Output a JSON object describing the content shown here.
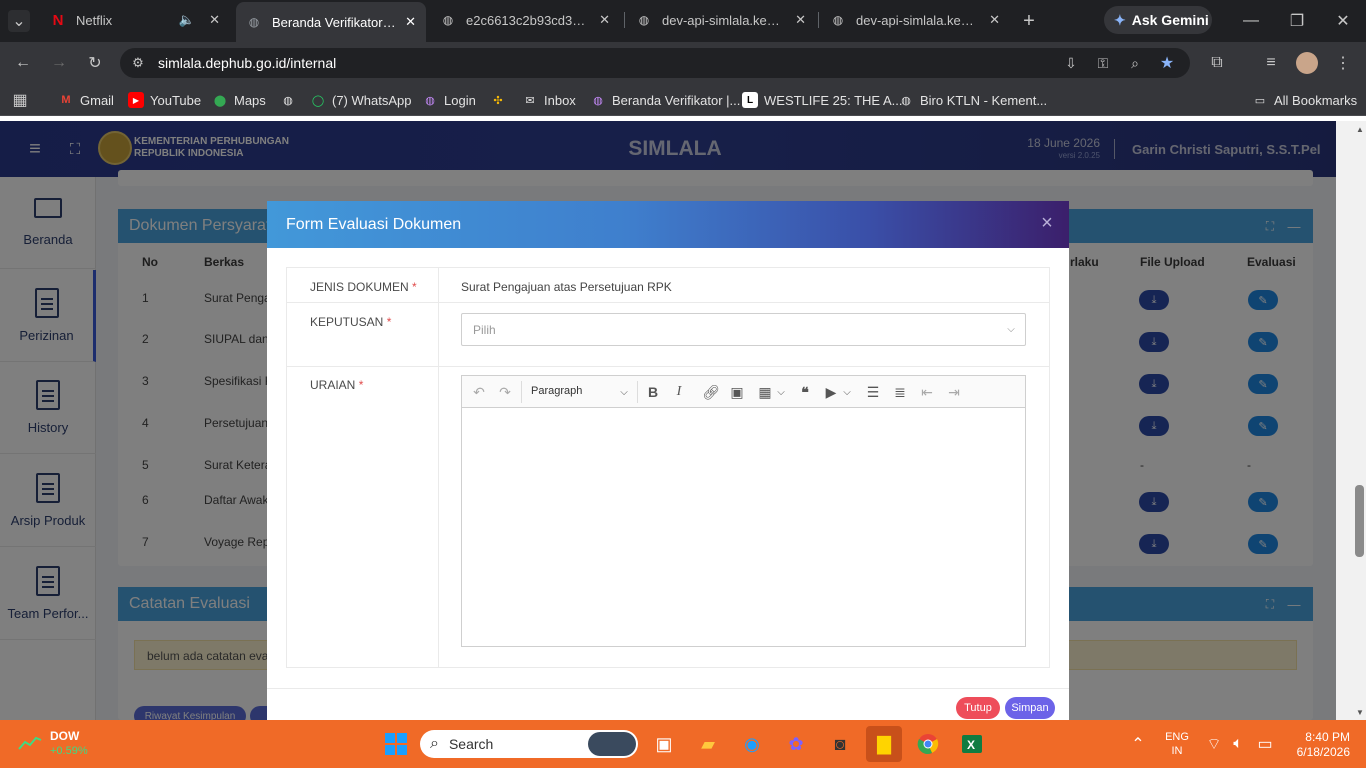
{
  "browser": {
    "tabs": [
      {
        "title": "Netflix",
        "icon": "netflix-icon"
      },
      {
        "title": "Beranda Verifikator | Si",
        "icon": "globe-icon"
      },
      {
        "title": "e2c6613c2b93cd31826",
        "icon": "globe-icon"
      },
      {
        "title": "dev-api-simlala.kemen",
        "icon": "globe-icon"
      },
      {
        "title": "dev-api-simlala.kemen",
        "icon": "globe-icon"
      }
    ],
    "ask_gemini": "Ask Gemini",
    "url": "simlala.dephub.go.id/internal",
    "bookmarks": [
      "Gmail",
      "YouTube",
      "Maps",
      "(7) WhatsApp",
      "Login",
      "Inbox",
      "Beranda Verifikator |...",
      "WESTLIFE 25: THE A...",
      "Biro KTLN - Kement..."
    ],
    "all_bookmarks": "All Bookmarks"
  },
  "app": {
    "org_line1": "KEMENTERIAN PERHUBUNGAN",
    "org_line2": "REPUBLIK INDONESIA",
    "title": "SIMLALA",
    "date": "18 June 2026",
    "version": "versi 2.0.25",
    "user": "Garin Christi Saputri, S.S.T.Pel",
    "sidebar": [
      "Beranda",
      "Perizinan",
      "History",
      "Arsip Produk",
      "Team Perfor..."
    ]
  },
  "documents": {
    "title": "Dokumen Persyarat",
    "headers": {
      "no": "No",
      "berkas": "Berkas",
      "berlaku": "rlaku",
      "file_upload": "File Upload",
      "evaluasi": "Evaluasi"
    },
    "rows": [
      {
        "no": "1",
        "berkas": "Surat Pengaj"
      },
      {
        "no": "2",
        "berkas": "SIUPAL dan E"
      },
      {
        "no": "3",
        "berkas": "Spesifikasi Ka"
      },
      {
        "no": "4",
        "berkas": "Persetujuan S"
      },
      {
        "no": "5",
        "berkas": "Surat Keterar",
        "file": "-",
        "eval": "-"
      },
      {
        "no": "6",
        "berkas": "Daftar Awak"
      },
      {
        "no": "7",
        "berkas": "Voyage Repo"
      }
    ]
  },
  "catatan": {
    "title": "Catatan Evaluasi",
    "empty_prefix": "belum ada catatan evalu",
    "button": "Riwayat Kesimpulan"
  },
  "modal": {
    "title": "Form Evaluasi Dokumen",
    "close": "×",
    "jenis_label": "JENIS DOKUMEN",
    "jenis_value": "Surat Pengajuan atas Persetujuan RPK",
    "keputusan_label": "KEPUTUSAN",
    "keputusan_placeholder": "Pilih",
    "uraian_label": "URAIAN",
    "required_mark": "*",
    "editor_style": "Paragraph",
    "btn_close": "Tutup",
    "btn_save": "Simpan"
  },
  "taskbar": {
    "stock_name": "DOW",
    "stock_change": "+0.59%",
    "search": "Search",
    "lang1": "ENG",
    "lang2": "IN",
    "time": "8:40 PM",
    "date": "6/18/2026"
  },
  "colors": {
    "accent": "#4aa5e0",
    "header": "#2b3a8f",
    "danger": "#ee4d5a",
    "primary": "#6c63e8"
  }
}
